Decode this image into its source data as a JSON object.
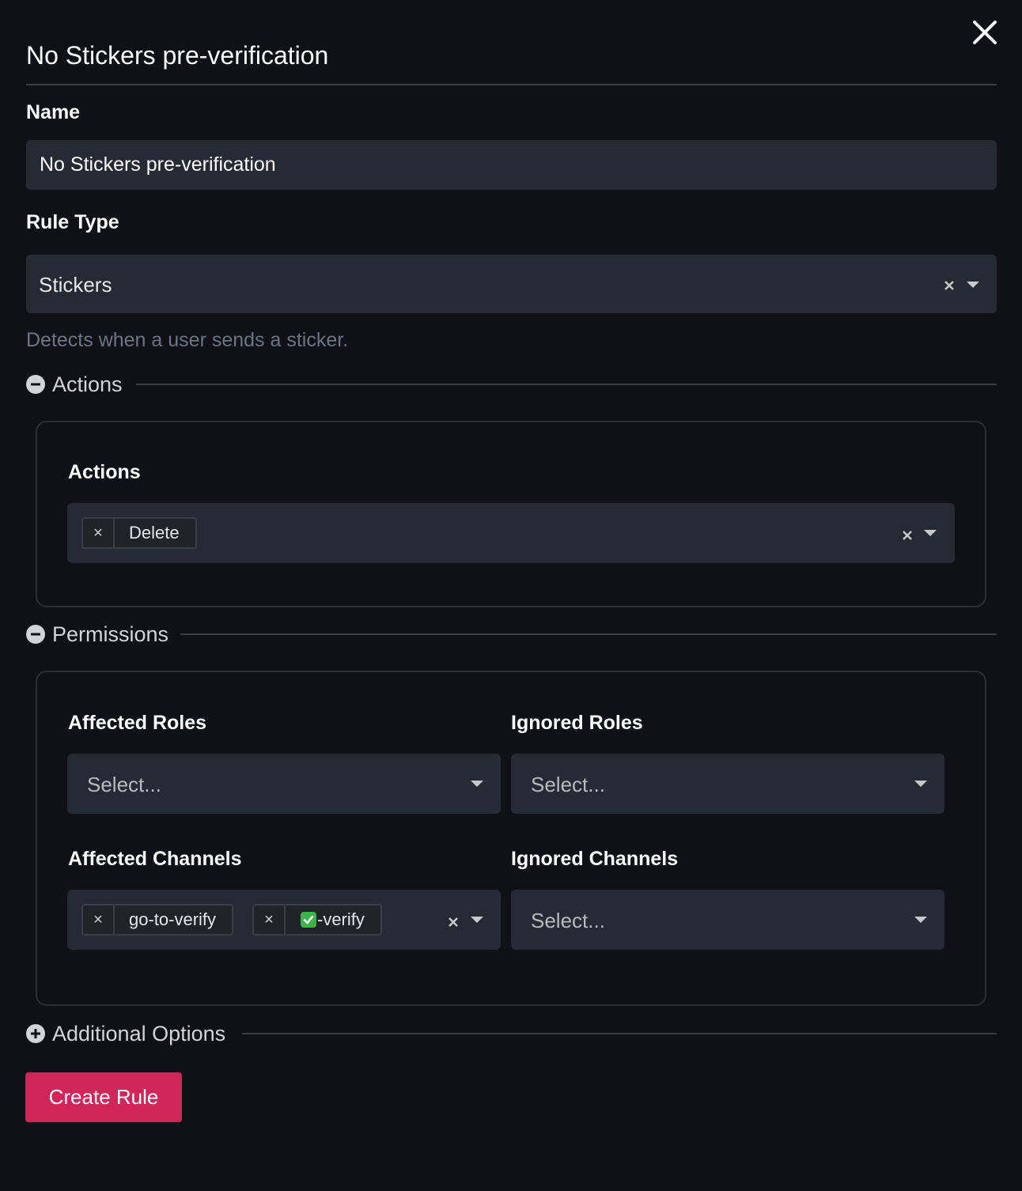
{
  "modal": {
    "title": "No Stickers pre-verification",
    "close_icon": "close-icon"
  },
  "name_field": {
    "label": "Name",
    "value": "No Stickers pre-verification"
  },
  "rule_type": {
    "label": "Rule Type",
    "value": "Stickers",
    "help": "Detects when a user sends a sticker."
  },
  "actions_section": {
    "label": "Actions",
    "icon": "collapse-minus-icon",
    "field_label": "Actions",
    "chips": [
      {
        "label": "Delete"
      }
    ]
  },
  "permissions_section": {
    "label": "Permissions",
    "icon": "collapse-minus-icon",
    "affected_roles": {
      "label": "Affected Roles",
      "placeholder": "Select..."
    },
    "ignored_roles": {
      "label": "Ignored Roles",
      "placeholder": "Select..."
    },
    "affected_channels": {
      "label": "Affected Channels",
      "chips": [
        {
          "label": "go-to-verify"
        },
        {
          "emoji": "check-mark-button-icon",
          "label": "-verify"
        }
      ]
    },
    "ignored_channels": {
      "label": "Ignored Channels",
      "placeholder": "Select..."
    }
  },
  "additional_section": {
    "label": "Additional Options",
    "icon": "expand-plus-icon"
  },
  "create_button": {
    "label": "Create Rule",
    "color": "#d0265a"
  }
}
